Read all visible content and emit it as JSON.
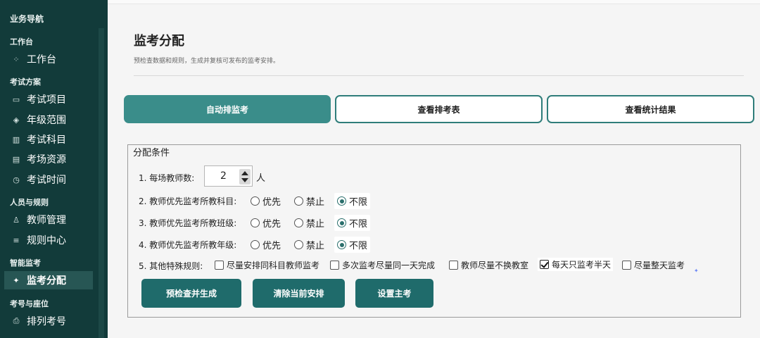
{
  "sidebar": {
    "title": "业务导航",
    "groups": [
      {
        "heading": "工作台",
        "items": [
          {
            "label": "工作台",
            "icon": "grid-icon"
          }
        ]
      },
      {
        "heading": "考试方案",
        "items": [
          {
            "label": "考试项目",
            "icon": "calendar-icon"
          },
          {
            "label": "年级范围",
            "icon": "layers-icon"
          },
          {
            "label": "考试科目",
            "icon": "book-icon"
          },
          {
            "label": "考场资源",
            "icon": "building-icon"
          },
          {
            "label": "考试时间",
            "icon": "clock-icon"
          }
        ]
      },
      {
        "heading": "人员与规则",
        "items": [
          {
            "label": "教师管理",
            "icon": "person-icon"
          },
          {
            "label": "规则中心",
            "icon": "sliders-icon"
          }
        ]
      },
      {
        "heading": "智能监考",
        "items": [
          {
            "label": "监考分配",
            "icon": "sparkle-icon",
            "active": true
          }
        ]
      },
      {
        "heading": "考号与座位",
        "items": [
          {
            "label": "排列考号",
            "icon": "printer-icon"
          }
        ]
      }
    ]
  },
  "page": {
    "title": "监考分配",
    "subtitle": "预检查数据和规则，生成并复核可发布的监考安排。"
  },
  "tabs": [
    {
      "label": "自动排监考",
      "active": true
    },
    {
      "label": "查看排考表",
      "active": false
    },
    {
      "label": "查看统计结果",
      "active": false
    }
  ],
  "conditions": {
    "legend": "分配条件",
    "teachers_per_room": {
      "label": "1. 每场教师数:",
      "value": "2",
      "unit": "人"
    },
    "radio_rows": [
      {
        "label": "2. 教师优先监考所教科目:",
        "options": [
          "优先",
          "禁止",
          "不限"
        ],
        "selected": "不限"
      },
      {
        "label": "3. 教师优先监考所教班级:",
        "options": [
          "优先",
          "禁止",
          "不限"
        ],
        "selected": "不限"
      },
      {
        "label": "4. 教师优先监考所教年级:",
        "options": [
          "优先",
          "禁止",
          "不限"
        ],
        "selected": "不限"
      }
    ],
    "special_rules": {
      "label": "5. 其他特殊规则:",
      "options": [
        {
          "label": "尽量安排同科目教师监考",
          "checked": false
        },
        {
          "label": "多次监考尽量同一天完成",
          "checked": false
        },
        {
          "label": "教师尽量不换教室",
          "checked": false
        },
        {
          "label": "每天只监考半天",
          "checked": true
        },
        {
          "label": "尽量整天监考",
          "checked": false
        }
      ]
    }
  },
  "actions": [
    {
      "label": "预检查并生成"
    },
    {
      "label": "清除当前安排"
    },
    {
      "label": "设置主考"
    }
  ],
  "colors": {
    "sidebar_bg": "#123b3a",
    "accent": "#3a8d8a",
    "button_dark": "#1f6b6b"
  }
}
